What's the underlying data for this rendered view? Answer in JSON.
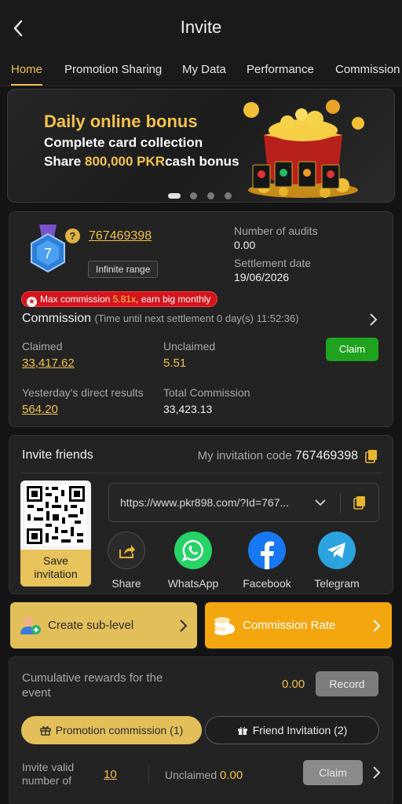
{
  "header": {
    "title": "Invite",
    "back_icon": "chevron-left-icon"
  },
  "tabs": [
    {
      "label": "Home",
      "active": true
    },
    {
      "label": "Promotion Sharing"
    },
    {
      "label": "My Data"
    },
    {
      "label": "Performance"
    },
    {
      "label": "Commission"
    }
  ],
  "banner": {
    "title": "Daily online bonus",
    "line1": "Complete card collection",
    "line2_prefix": "Share ",
    "line2_highlight": "800,000 PKR",
    "line2_suffix": "cash bonus",
    "slide_count": 4,
    "active_slide": 1
  },
  "account": {
    "level": "7",
    "user_id": "767469398",
    "range_badge": "Infinite range",
    "audits_label": "Number of audits",
    "audits_value": "0.00",
    "settlement_label": "Settlement date",
    "settlement_value": "19/06/2026",
    "max_commission_prefix": "Max commission ",
    "max_commission_value": "5.81x",
    "max_commission_suffix": ", earn big monthly",
    "commission_title": "Commission",
    "commission_sub": "(Time until next settlement  0 day(s) 11:52:36)",
    "claimed_label": "Claimed",
    "claimed_value": "33,417.62",
    "unclaimed_label": "Unclaimed",
    "unclaimed_value": "5.51",
    "claim_button": "Claim",
    "yesterday_label": "Yesterday's direct results",
    "yesterday_value": "564.20",
    "total_label": "Total Commission",
    "total_value": "33,423.13"
  },
  "invite": {
    "title": "Invite friends",
    "code_label": "My invitation code",
    "code_value": "767469398",
    "link": "https://www.pkr898.com/?Id=767...",
    "save_label": "Save invitation",
    "share_targets": [
      {
        "label": "Share",
        "icon": "share-icon",
        "color": "#2b2b2b"
      },
      {
        "label": "WhatsApp",
        "icon": "whatsapp-icon",
        "color": "#25d366"
      },
      {
        "label": "Facebook",
        "icon": "facebook-icon",
        "color": "#1877f2"
      },
      {
        "label": "Telegram",
        "icon": "telegram-icon",
        "color": "#2aa3df"
      }
    ]
  },
  "actions": {
    "sub_level": "Create sub-level",
    "commission_rate": "Commission Rate"
  },
  "rewards": {
    "cumulative_label": "Cumulative rewards for the event",
    "cumulative_value": "0.00",
    "record_button": "Record",
    "promotion_tab": "Promotion commission (1)",
    "friend_tab": "Friend Invitation (2)",
    "valid_label": "Invite valid number of",
    "valid_value": "10",
    "unclaimed_label": "Unclaimed",
    "unclaimed_value": "0.00",
    "claim_button": "Claim"
  },
  "colors": {
    "accent": "#f0c24a",
    "claim_green": "#1fa31f",
    "orange": "#f4a60e"
  }
}
